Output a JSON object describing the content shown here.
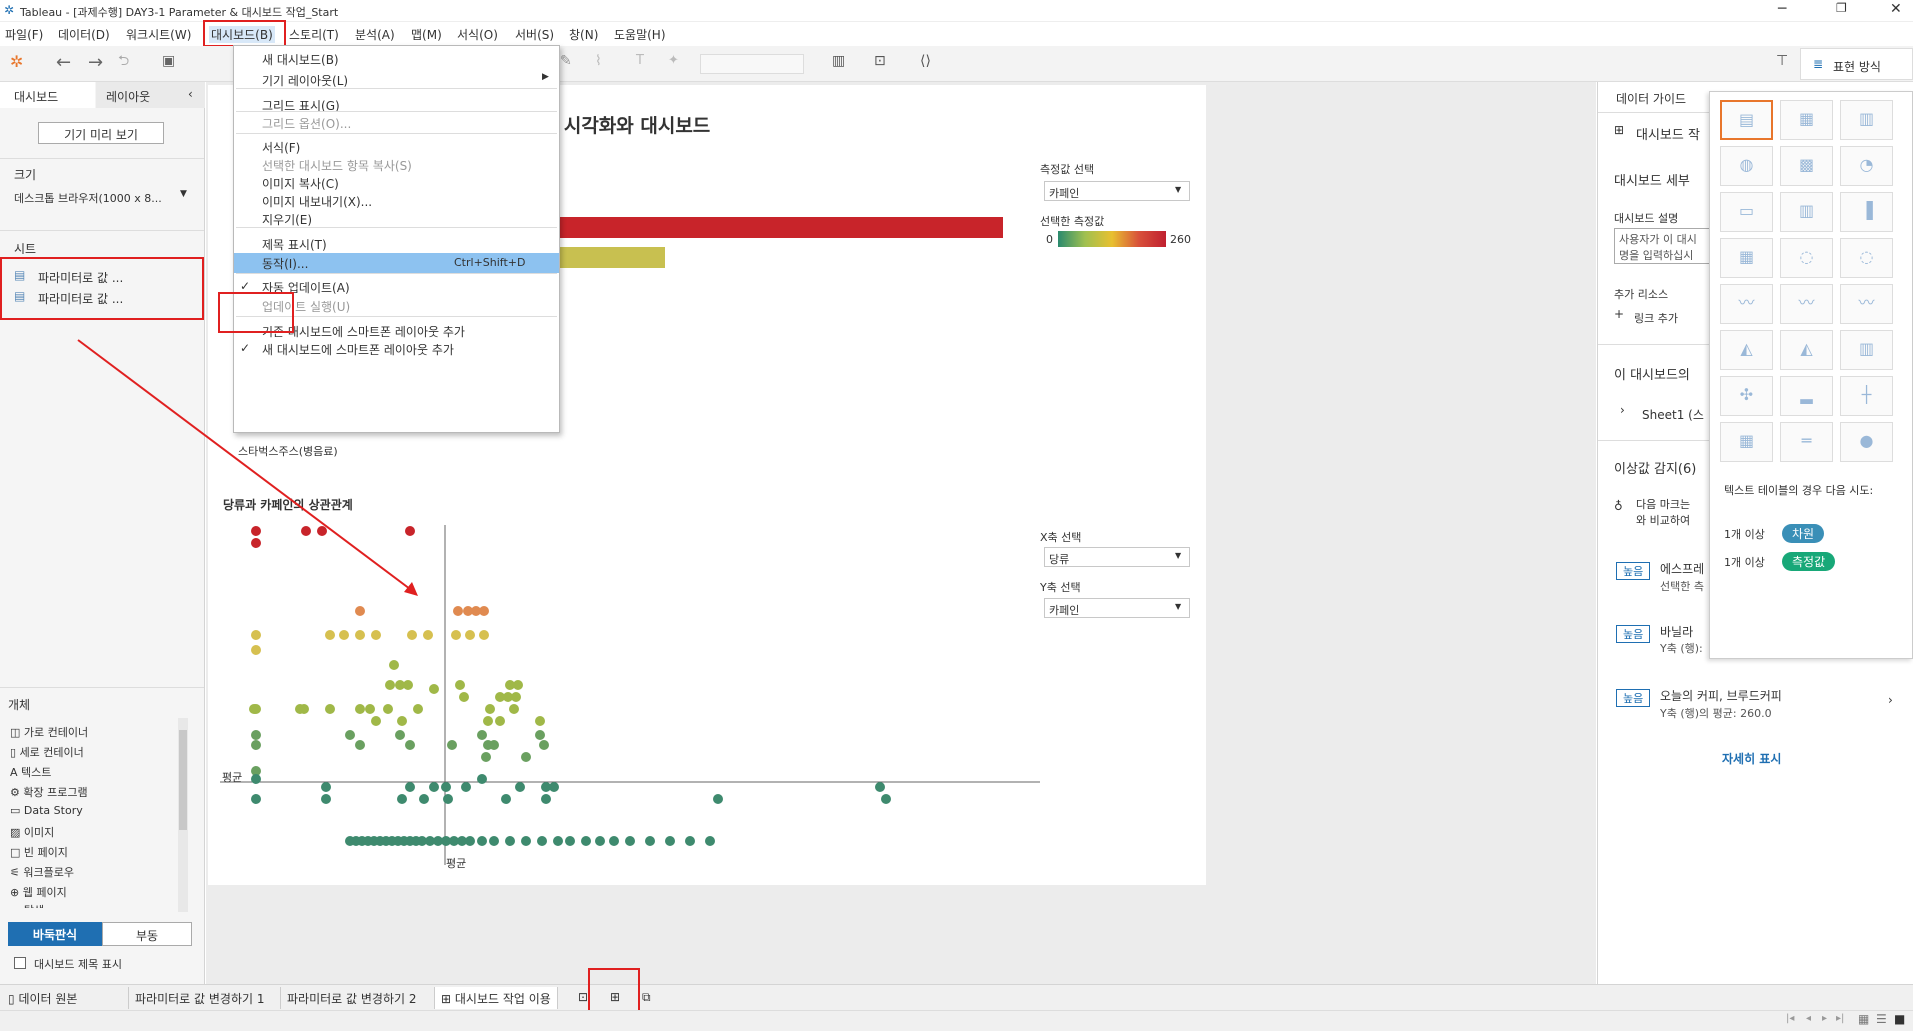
{
  "window": {
    "title": "Tableau - [과제수행] DAY3-1 Parameter & 대시보드 작업_Start"
  },
  "menubar": [
    "파일(F)",
    "데이터(D)",
    "워크시트(W)",
    "대시보드(B)",
    "스토리(T)",
    "분석(A)",
    "맵(M)",
    "서식(O)",
    "서버(S)",
    "창(N)",
    "도움말(H)"
  ],
  "dashboard_menu": {
    "items": [
      {
        "label": "새 대시보드(B)",
        "enabled": true
      },
      {
        "label": "기기 레이아웃(L)",
        "enabled": true,
        "submenu": true
      },
      {
        "label": "그리드 표시(G)",
        "enabled": true
      },
      {
        "label": "그리드 옵션(O)...",
        "enabled": false
      },
      {
        "label": "서식(F)",
        "enabled": true
      },
      {
        "label": "선택한 대시보드 항목 복사(S)",
        "enabled": false
      },
      {
        "label": "이미지 복사(C)",
        "enabled": true
      },
      {
        "label": "이미지 내보내기(X)...",
        "enabled": true
      },
      {
        "label": "지우기(E)",
        "enabled": true
      },
      {
        "label": "제목 표시(T)",
        "enabled": true
      },
      {
        "label": "동작(I)...",
        "shortcut": "Ctrl+Shift+D",
        "highlighted": true
      },
      {
        "label": "자동 업데이트(A)",
        "checked": true
      },
      {
        "label": "업데이트 실행(U)",
        "enabled": false
      },
      {
        "label": "기존 대시보드에 스마트폰 레이아웃 추가",
        "enabled": true
      },
      {
        "label": "새 대시보드에 스마트폰 레이아웃 추가",
        "checked": true
      }
    ]
  },
  "left_pane": {
    "tabs": [
      "대시보드",
      "레이아웃"
    ],
    "device_preview": "기기 미리 보기",
    "size_label": "크기",
    "size_value": "데스크톱 브라우저(1000 x 8...",
    "sheets_label": "시트",
    "sheets": [
      "파라미터로 값 ...",
      "파라미터로 값 ..."
    ],
    "objects_label": "개체",
    "objects": [
      "가로 컨테이너",
      "세로 컨테이너",
      "텍스트",
      "확장 프로그램",
      "Data Story",
      "이미지",
      "빈 페이지",
      "워크플로우",
      "웹 페이지",
      "탐색"
    ],
    "tiled": "바둑판식",
    "floating": "부동",
    "show_title": "대시보드 제목 표시"
  },
  "dashboard": {
    "title": "· 시각화와 대시보드",
    "measure_select_label": "측정값 선택",
    "measure_select_value": "카페인",
    "selected_measure_label": "선택한 측정값",
    "legend_min": "0",
    "legend_max": "260",
    "bar1_fraction": 1.0,
    "bar2_fraction": 0.24,
    "text_starbucks": "스타벅스주스(병음료)",
    "scatter_title": "당류과 카페인의 상관관계",
    "x_select_label": "X축 선택",
    "x_select_value": "당류",
    "y_select_label": "Y축 선택",
    "y_select_value": "카페인",
    "avg_label": "평균",
    "avg_label_x": "평균"
  },
  "right_pane": {
    "header": "데이터 가이드",
    "dashboard_item": "대시보드 작",
    "detail_label": "대시보드 세부 ",
    "desc_label": "대시보드 설명",
    "desc_placeholder_1": "사용자가 이 대시",
    "desc_placeholder_2": "명을 입력하십시",
    "resources_label": "추가 리소스",
    "add_link": "링크 추가",
    "this_dashboard": "이 대시보드의 ",
    "sheet1": "Sheet1 (스",
    "outliers": "이상값 감지(6)",
    "tip_1": "다음 마크는 ",
    "tip_2": "와 비교하여 ",
    "high": "높음",
    "o1_title": "에스프레",
    "o1_sub": "선택한 측",
    "o2_title": "바닐라 ",
    "o2_sub": "Y축 (행):",
    "o3_title": "오늘의 커피, 브루드커피",
    "o3_sub": "Y축 (행)의 평균: 260.0",
    "more": "자세히 표시",
    "show_me_tab": "표현 방식"
  },
  "show_me": {
    "hint": "텍스트 테이블의 경우 다음 시도:",
    "row1_prefix": "1개 이상",
    "row1_pill": "차원",
    "row2_prefix": "1개 이상",
    "row2_pill": "측정값"
  },
  "bottom_tabs": [
    "데이터 원본",
    "파라미터로 값 변경하기 1",
    "파라미터로 값 변경하기 2",
    "대시보드 작업 이용"
  ],
  "colors": {
    "accent_blue": "#1f6fb2",
    "highlight": "#8dc2f0",
    "red_box": "#e02020",
    "dim_pill": "#3a8fb7",
    "measure_pill": "#18a878"
  }
}
